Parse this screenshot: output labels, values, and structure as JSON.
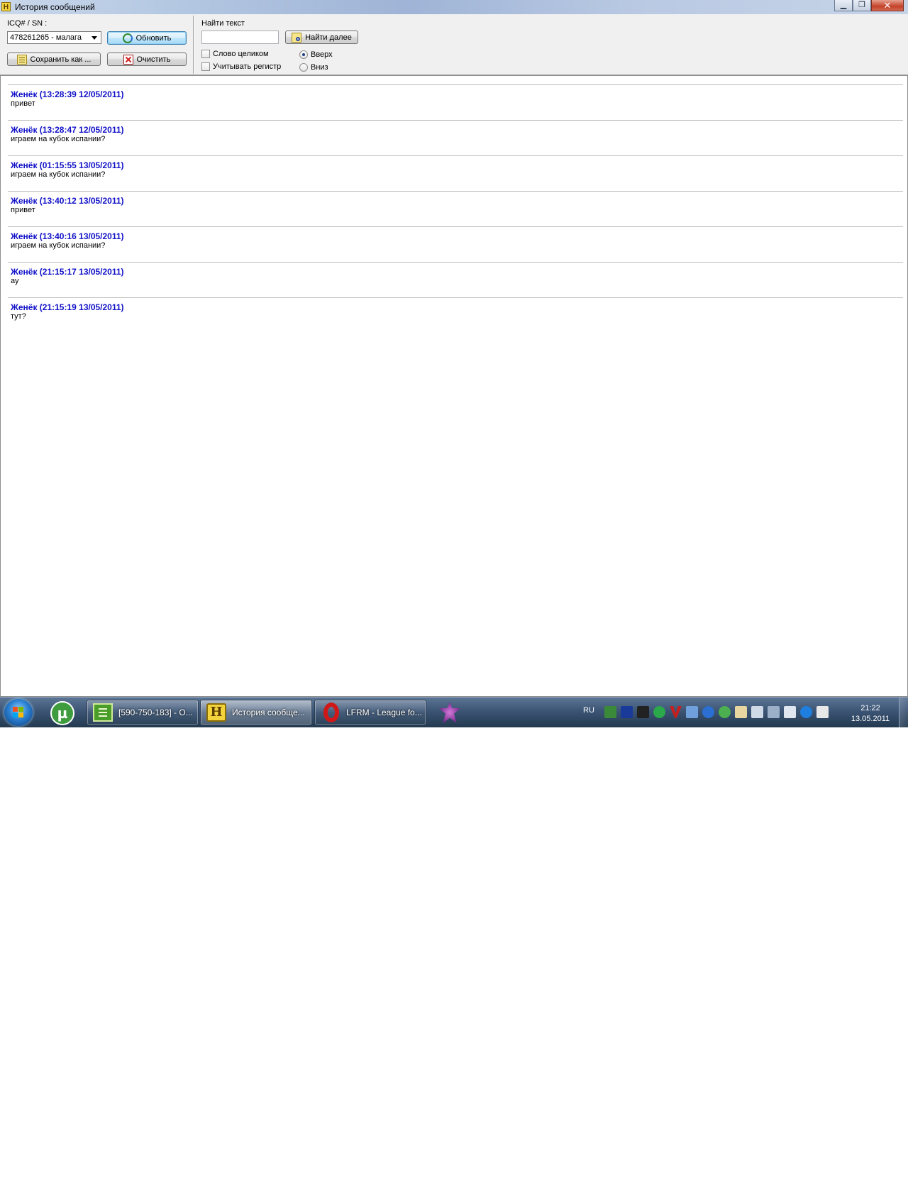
{
  "window": {
    "title": "История сообщений",
    "app_icon_letter": "H"
  },
  "toolbar": {
    "contact_label": "ICQ# / SN :",
    "contact_value": "478261265 - малага",
    "refresh_label": "Обновить",
    "save_label": "Сохранить как ...",
    "clear_label": "Очистить",
    "find_label": "Найти текст",
    "find_value": "",
    "find_next_label": "Найти далее",
    "whole_word_label": "Слово целиком",
    "whole_word_checked": false,
    "match_case_label": "Учитывать регистр",
    "match_case_checked": false,
    "dir_up_label": "Вверх",
    "dir_down_label": "Вниз",
    "direction_selected": "up"
  },
  "messages": [
    {
      "header": "Женёк (13:28:39 12/05/2011)",
      "text": "привет"
    },
    {
      "header": "Женёк (13:28:47 12/05/2011)",
      "text": "играем на кубок испании?"
    },
    {
      "header": "Женёк (01:15:55 13/05/2011)",
      "text": "играем на кубок испании?"
    },
    {
      "header": "Женёк (13:40:12 13/05/2011)",
      "text": "привет"
    },
    {
      "header": "Женёк (13:40:16 13/05/2011)",
      "text": "играем на кубок испании?"
    },
    {
      "header": "Женёк (21:15:17 13/05/2011)",
      "text": "ау"
    },
    {
      "header": "Женёк (21:15:19 13/05/2011)",
      "text": "тут?"
    }
  ],
  "taskbar": {
    "tasks": [
      {
        "label": "[590-750-183] - О...",
        "icon": "notes-icon"
      },
      {
        "label": "История сообще...",
        "icon": "history-h-icon",
        "active": true
      },
      {
        "label": "LFRM - League fo...",
        "icon": "opera-icon"
      }
    ],
    "language": "RU",
    "time": "21:22",
    "date": "13.05.2011"
  },
  "colors": {
    "message_header": "#1010c8",
    "taskbar": "#3c5575"
  }
}
